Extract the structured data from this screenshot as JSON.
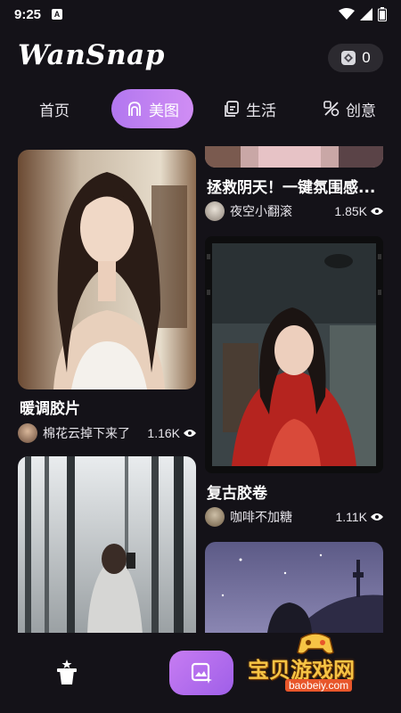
{
  "status_bar": {
    "time": "9:25",
    "badge": "A"
  },
  "header": {
    "app_title": "WanSnap",
    "coin_count": "0"
  },
  "tabs": [
    {
      "label": "首页",
      "icon": "none",
      "active": false
    },
    {
      "label": "美图",
      "icon": "portrait-outline-icon",
      "active": true
    },
    {
      "label": "生活",
      "icon": "photo-stack-icon",
      "active": false
    },
    {
      "label": "创意",
      "icon": "creative-tools-icon",
      "active": false
    }
  ],
  "feed": {
    "left": [
      {
        "title": "暖调胶片",
        "author": "棉花云掉下来了",
        "views": "1.16K"
      },
      {
        "title": "",
        "author": "",
        "views": ""
      }
    ],
    "right": [
      {
        "title": "拯救阴天！一键氛围感...",
        "author": "夜空小翻滚",
        "views": "1.85K"
      },
      {
        "title": "复古胶卷",
        "author": "咖啡不加糖",
        "views": "1.11K"
      },
      {
        "title": "",
        "author": "",
        "views": ""
      }
    ]
  },
  "watermark": {
    "text": "宝贝游戏网",
    "url": "baobeiy.com"
  },
  "colors": {
    "background": "#141218",
    "accent": "#c17ff2",
    "coin_pill": "#2c2a30"
  }
}
